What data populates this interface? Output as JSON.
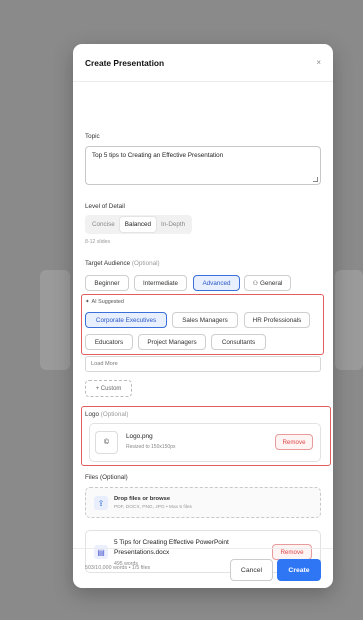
{
  "modal": {
    "title": "Create Presentation",
    "close": "×"
  },
  "topic": {
    "label": "Topic",
    "value": "Top 5 tips to Creating an Effective Presentation"
  },
  "detail": {
    "label": "Level of Detail",
    "options": [
      "Concise",
      "Balanced",
      "In-Depth"
    ],
    "selected": "Balanced",
    "hint": "8-12 slides"
  },
  "audience": {
    "label": "Target Audience",
    "optional": "(Optional)",
    "levels": [
      "Beginner",
      "Intermediate",
      "Advanced",
      "General"
    ],
    "selected_level": "Advanced",
    "ai_label": "AI Suggested",
    "suggestions": [
      "Corporate Executives",
      "Sales Managers",
      "HR Professionals",
      "Educators",
      "Project Managers",
      "Consultants"
    ],
    "selected_suggestion": "Corporate Executives",
    "load_more": "Load More",
    "custom": "+ Custom"
  },
  "logo": {
    "label": "Logo",
    "optional": "(Optional)",
    "thumb": "©",
    "file_name": "Logo.png",
    "meta": "Resized to 150x150px",
    "remove": "Remove"
  },
  "files": {
    "label": "Files (Optional)",
    "drop_title": "Drop files or browse",
    "drop_sub": "PDF, DOCX, PNG, JPG • Max 5 files",
    "items": [
      {
        "name": "5 Tips for Creating Effective PowerPoint Presentations.docx",
        "meta": "495 words",
        "remove": "Remove"
      }
    ]
  },
  "footer": {
    "status": "503/10,000 words • 1/5 files",
    "cancel": "Cancel",
    "create": "Create"
  },
  "colors": {
    "accent": "#2f76f4",
    "highlight_box": "#e25d5d",
    "remove": "#d44444"
  },
  "icons": {
    "ai": "sparkle-icon",
    "general": "users-icon",
    "upload": "upload-icon",
    "file": "document-icon"
  }
}
